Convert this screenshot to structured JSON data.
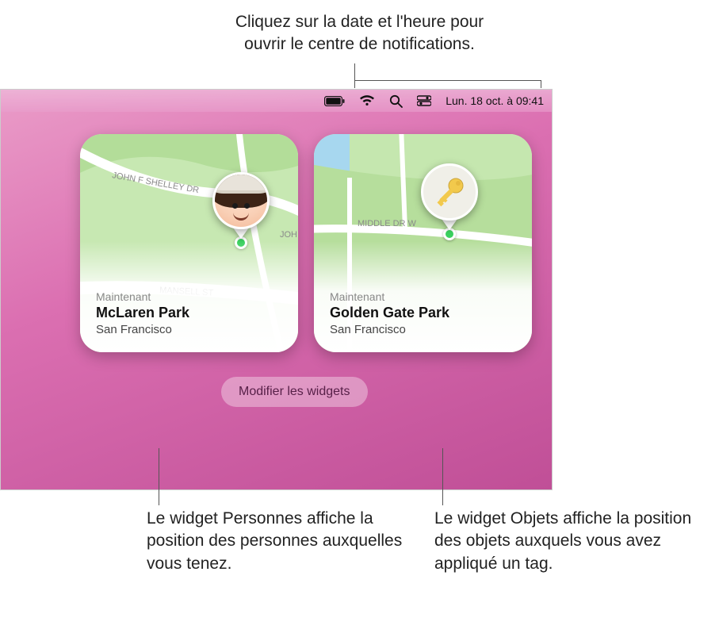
{
  "callouts": {
    "top_line1": "Cliquez sur la date et l'heure pour",
    "top_line2": "ouvrir le centre de notifications.",
    "bottom_left": "Le widget Personnes affiche la position des personnes auxquelles vous tenez.",
    "bottom_right": "Le widget Objets affiche la position des objets auxquels vous avez appliqué un tag."
  },
  "menubar": {
    "datetime": "Lun. 18 oct. à  09:41"
  },
  "widgets": {
    "people": {
      "timestamp": "Maintenant",
      "title": "McLaren Park",
      "city": "San Francisco",
      "roads": {
        "r1": "JOHN F SHELLEY DR",
        "r2": "MANSELL ST",
        "r3": "JOH"
      }
    },
    "items": {
      "timestamp": "Maintenant",
      "title": "Golden Gate Park",
      "city": "San Francisco",
      "roads": {
        "r1": "MIDDLE DR W"
      }
    }
  },
  "buttons": {
    "edit_widgets": "Modifier les widgets"
  }
}
